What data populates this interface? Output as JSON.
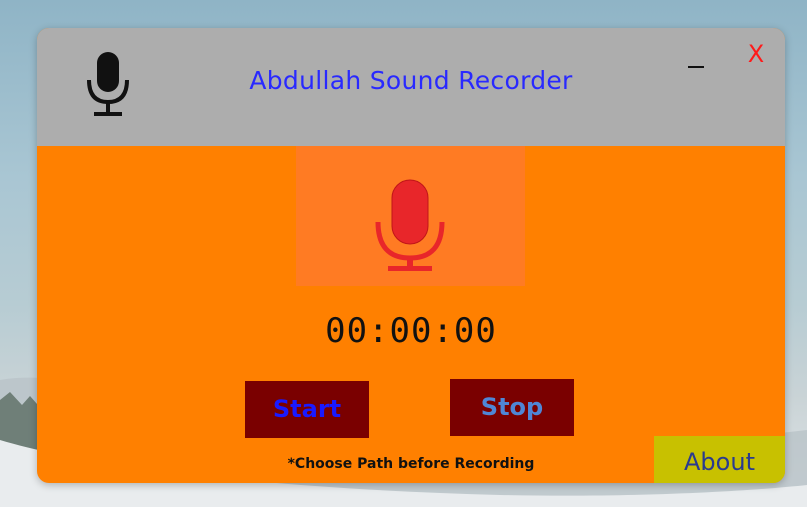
{
  "app": {
    "title": "Abdullah Sound Recorder",
    "minimize_label": "_",
    "close_label": "X"
  },
  "recorder": {
    "timer": "00:00:00",
    "start_label": "Start",
    "stop_label": "Stop",
    "note": "*Choose Path before Recording",
    "about_label": "About"
  },
  "icons": {
    "app_icon": "microphone-icon",
    "record_icon": "microphone-icon"
  },
  "colors": {
    "titlebar": "#adadad",
    "body": "#ff8000",
    "mic_panel": "#ff7b23",
    "title_text": "#2929ff",
    "close": "#ff1a1a",
    "button_bg": "#7a0000",
    "start_text": "#1a1aff",
    "stop_text": "#4f86d6",
    "about_bg": "#c8c100",
    "mic_red": "#e8262a"
  }
}
